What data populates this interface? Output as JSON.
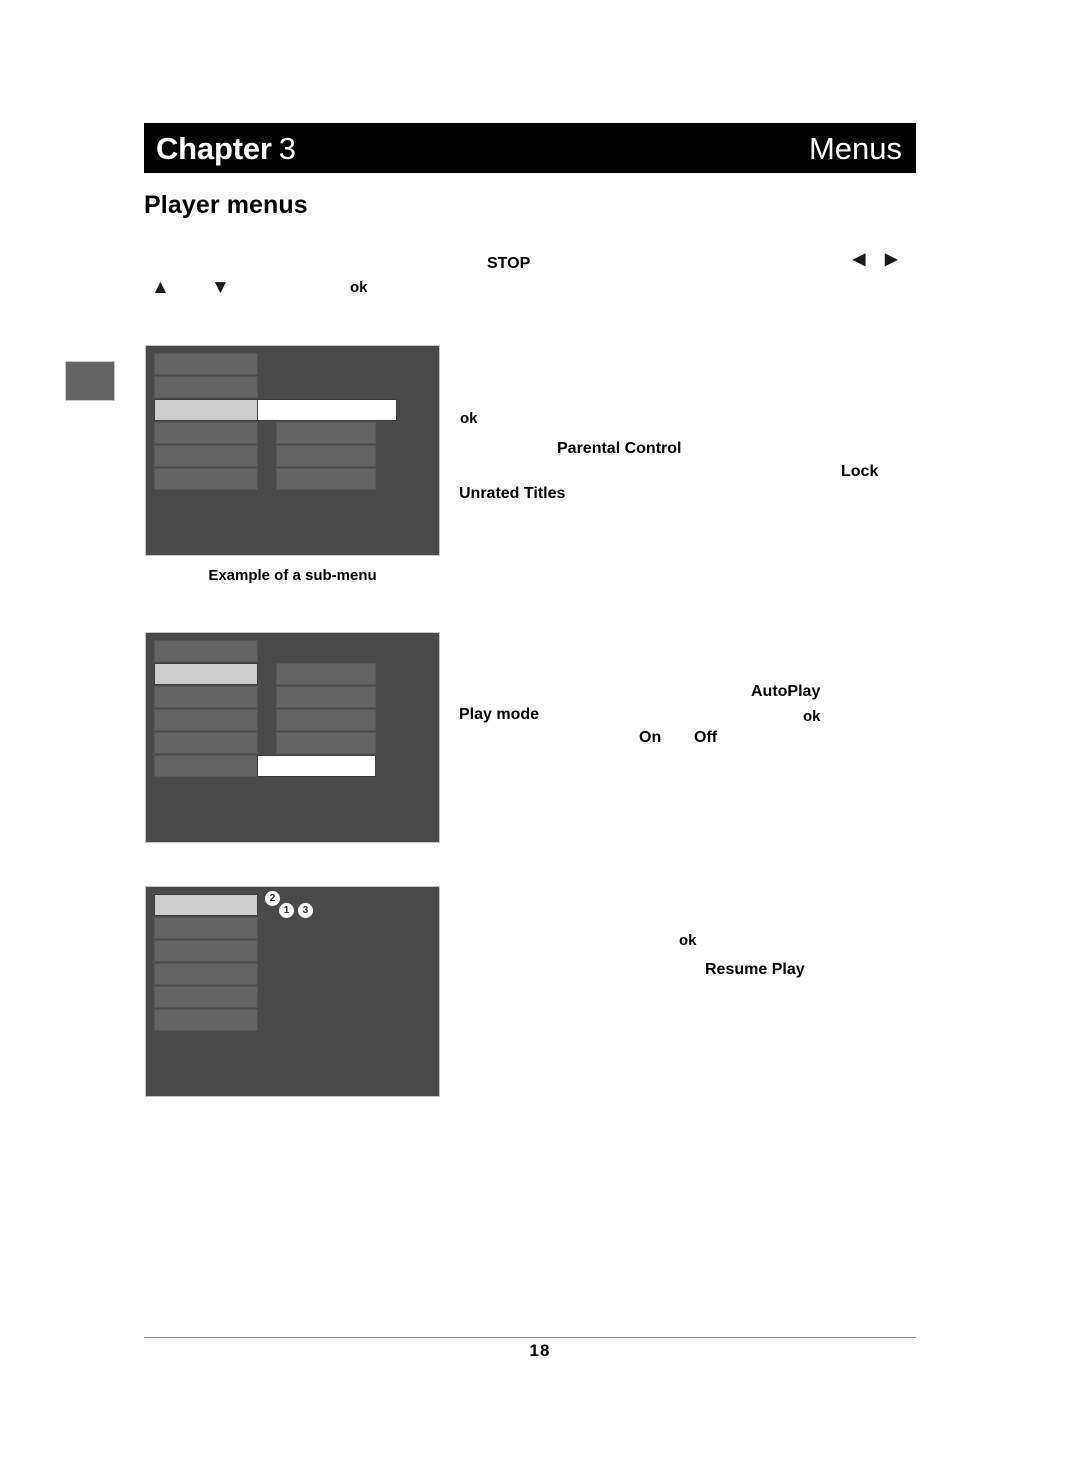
{
  "banner": {
    "chapter_label": "Chapter",
    "chapter_number": "3",
    "section_title": "Menus"
  },
  "heading": {
    "title": "Player menus"
  },
  "terms": {
    "stop": "STOP",
    "ok_nav": "ok",
    "ok_submenu": "ok",
    "parental_control": "Parental Control",
    "lock": "Lock",
    "unrated_titles": "Unrated Titles",
    "autoplay": "AutoPlay",
    "play_mode": "Play mode",
    "ok_playmode": "ok",
    "on": "On",
    "off": "Off",
    "ok_resume": "ok",
    "resume_play": "Resume Play"
  },
  "glyphs": {
    "up_arrow": "▲",
    "down_arrow": "▼",
    "left_arrow": "◀",
    "right_arrow": "▶"
  },
  "figures": [
    {
      "name": "sub-menu-example",
      "caption": "Example of a sub-menu",
      "left_rows": 6,
      "highlight_index": 3,
      "right_rows": 3,
      "selected_bar": true
    },
    {
      "name": "play-mode-menu",
      "caption": "",
      "left_rows": 6,
      "highlight_index": 2,
      "right_rows": 4,
      "selected_bar": true
    },
    {
      "name": "resume-play-menu",
      "caption": "",
      "left_rows": 6,
      "highlight_index": 1,
      "right_rows": 0,
      "badges": [
        "2",
        "1",
        "3"
      ]
    }
  ],
  "footer": {
    "page_number": "18"
  },
  "colors": {
    "banner_background": "#000000",
    "banner_text": "#ffffff",
    "figure_background": "#4a4a4a",
    "menu_row": "#646464",
    "menu_row_highlight": "#cdcdcd",
    "menu_row_selected": "#ffffff",
    "thumb_tab": "#646464",
    "footer_rule": "#8a8a8a"
  }
}
